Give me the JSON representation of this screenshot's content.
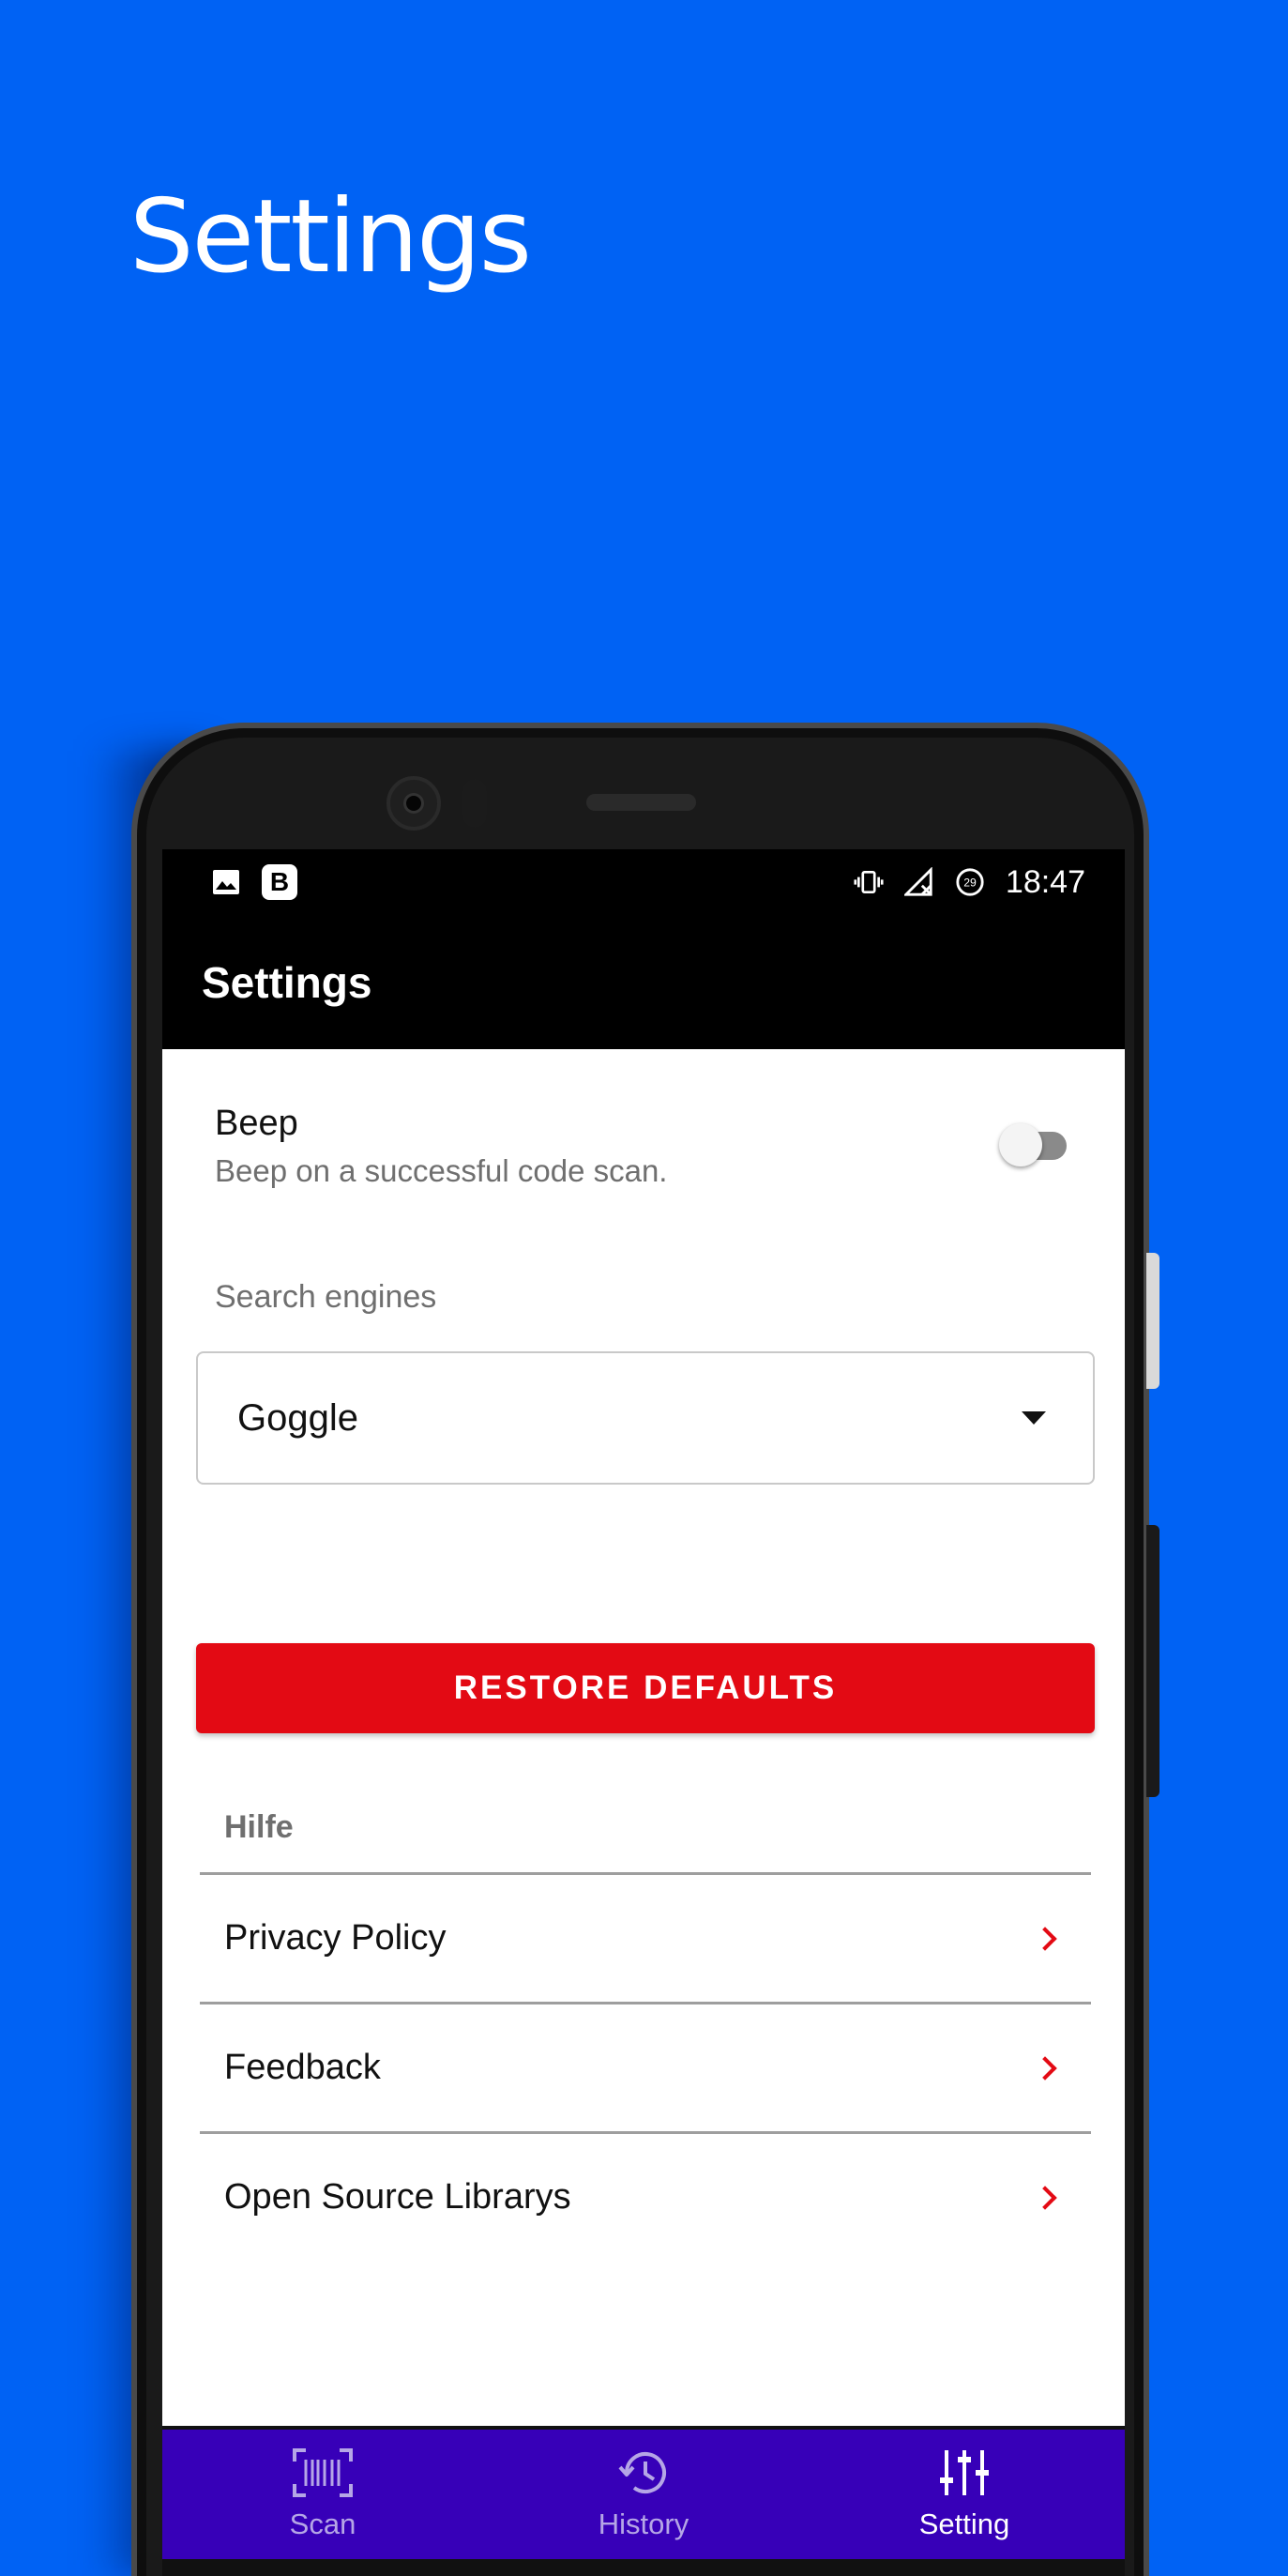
{
  "promo": {
    "title": "Settings"
  },
  "statusbar": {
    "time": "18:47",
    "badge_letter": "B",
    "battery_level": "29"
  },
  "appbar": {
    "title": "Settings"
  },
  "beep": {
    "title": "Beep",
    "subtitle": "Beep on a successful code scan.",
    "enabled": false
  },
  "search_engines": {
    "label": "Search engines",
    "selected": "Goggle"
  },
  "restore_button": {
    "label": "RESTORE DEFAULTS"
  },
  "help": {
    "label": "Hilfe",
    "items": [
      {
        "label": "Privacy Policy"
      },
      {
        "label": "Feedback"
      },
      {
        "label": "Open Source Librarys"
      }
    ]
  },
  "bottom_nav": {
    "items": [
      {
        "label": "Scan",
        "icon": "barcode-scan-icon",
        "active": false
      },
      {
        "label": "History",
        "icon": "history-icon",
        "active": false
      },
      {
        "label": "Setting",
        "icon": "tune-icon",
        "active": true
      }
    ]
  },
  "colors": {
    "background": "#0062F4",
    "accent": "#E30A14",
    "nav": "#3700B8"
  }
}
